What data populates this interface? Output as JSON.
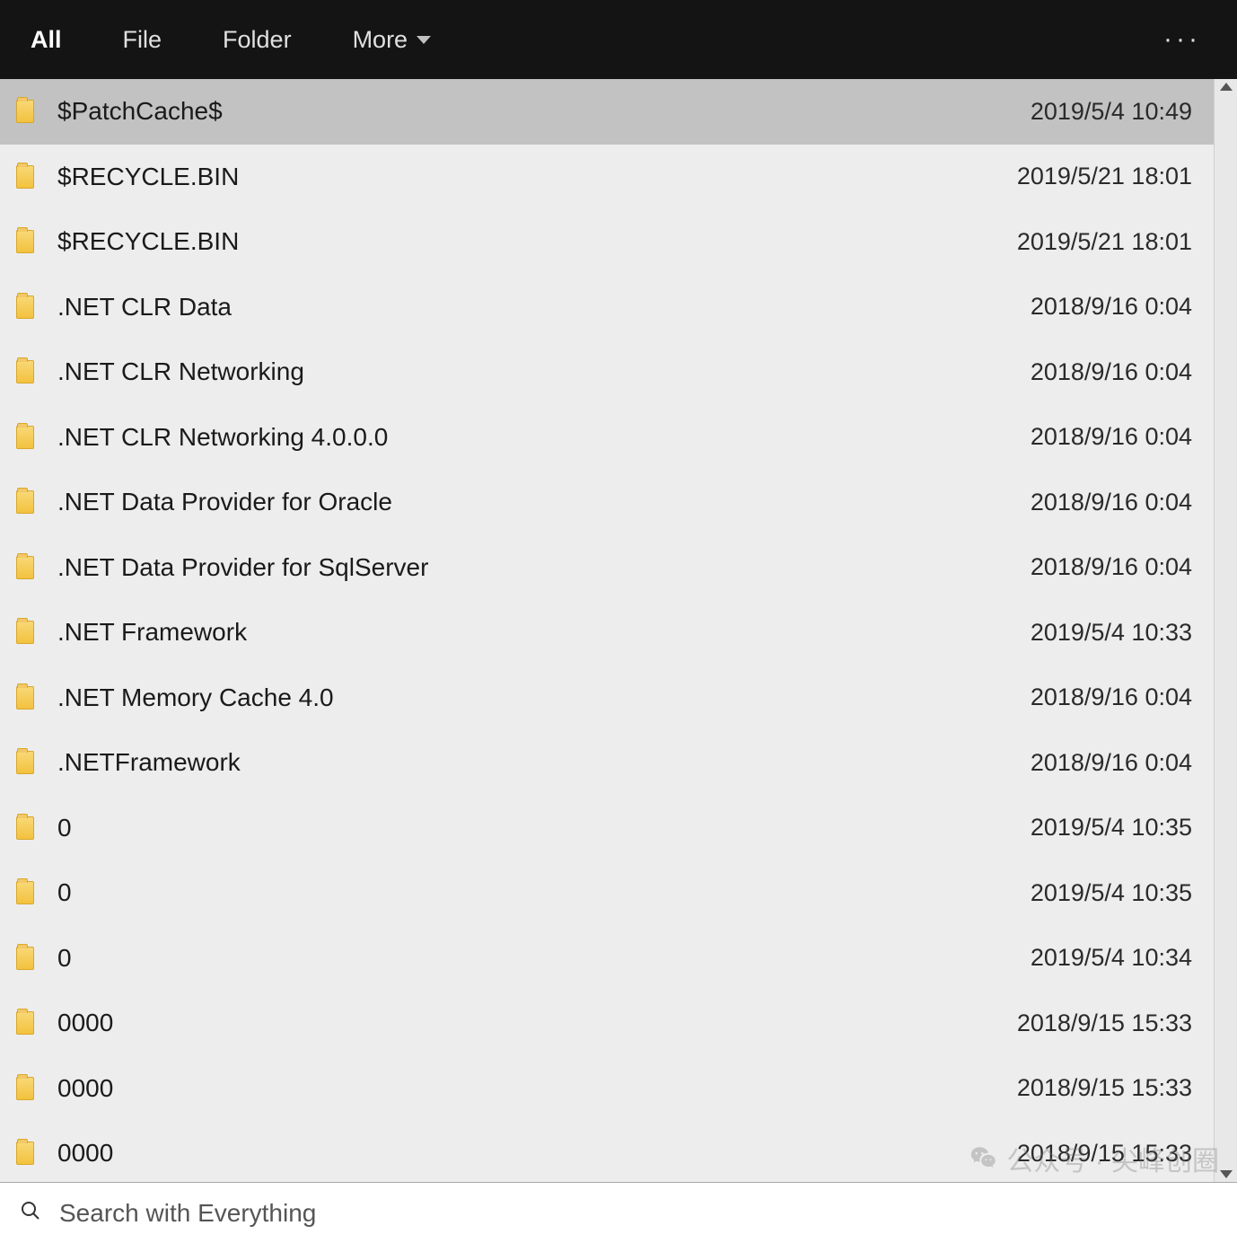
{
  "toolbar": {
    "tabs": [
      {
        "label": "All",
        "active": true
      },
      {
        "label": "File",
        "active": false
      },
      {
        "label": "Folder",
        "active": false
      }
    ],
    "more_label": "More",
    "overflow_label": "···"
  },
  "list": {
    "items": [
      {
        "name": "$PatchCache$",
        "date": "2019/5/4 10:49",
        "selected": true
      },
      {
        "name": "$RECYCLE.BIN",
        "date": "2019/5/21 18:01",
        "selected": false
      },
      {
        "name": "$RECYCLE.BIN",
        "date": "2019/5/21 18:01",
        "selected": false
      },
      {
        "name": ".NET CLR Data",
        "date": "2018/9/16 0:04",
        "selected": false
      },
      {
        "name": ".NET CLR Networking",
        "date": "2018/9/16 0:04",
        "selected": false
      },
      {
        "name": ".NET CLR Networking 4.0.0.0",
        "date": "2018/9/16 0:04",
        "selected": false
      },
      {
        "name": ".NET Data Provider for Oracle",
        "date": "2018/9/16 0:04",
        "selected": false
      },
      {
        "name": ".NET Data Provider for SqlServer",
        "date": "2018/9/16 0:04",
        "selected": false
      },
      {
        "name": ".NET Framework",
        "date": "2019/5/4 10:33",
        "selected": false
      },
      {
        "name": ".NET Memory Cache 4.0",
        "date": "2018/9/16 0:04",
        "selected": false
      },
      {
        "name": ".NETFramework",
        "date": "2018/9/16 0:04",
        "selected": false
      },
      {
        "name": "0",
        "date": "2019/5/4 10:35",
        "selected": false
      },
      {
        "name": "0",
        "date": "2019/5/4 10:35",
        "selected": false
      },
      {
        "name": "0",
        "date": "2019/5/4 10:34",
        "selected": false
      },
      {
        "name": "0000",
        "date": "2018/9/15 15:33",
        "selected": false
      },
      {
        "name": "0000",
        "date": "2018/9/15 15:33",
        "selected": false
      },
      {
        "name": "0000",
        "date": "2018/9/15 15:33",
        "selected": false
      }
    ]
  },
  "search": {
    "placeholder": "Search with Everything"
  },
  "watermark": {
    "text": "公众号 · 尖峰创圈"
  }
}
